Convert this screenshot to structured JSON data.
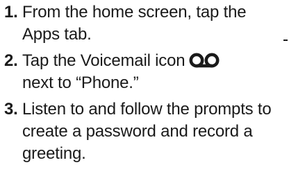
{
  "steps": [
    {
      "number": "1.",
      "text": "From the home screen, tap the Apps tab."
    },
    {
      "number": "2.",
      "text_before_icon": "Tap the Voicemail icon",
      "icon": "voicemail-icon",
      "text_after_icon": "next to “Phone.”"
    },
    {
      "number": "3.",
      "text": "Listen to and follow the prompts to create a password and record a greeting."
    }
  ]
}
